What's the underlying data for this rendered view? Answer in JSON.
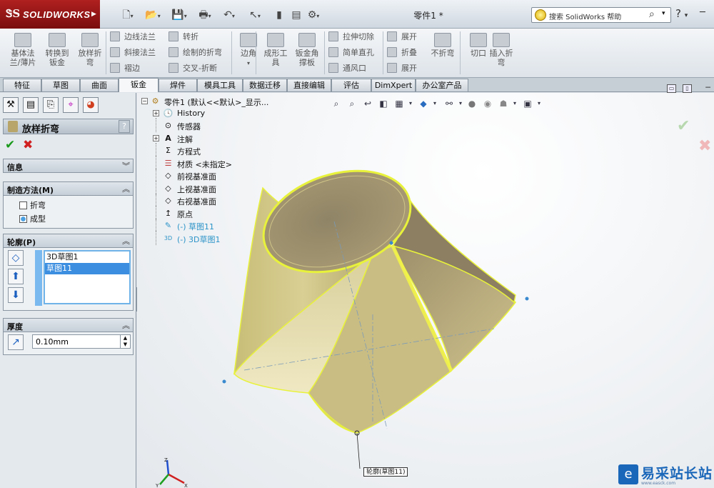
{
  "app": {
    "brand": "SOLIDWORKS",
    "doc_title": "零件1 *",
    "help_search": "搜索 SolidWorks 帮助",
    "help_btn": "?"
  },
  "ribbon": {
    "big_buttons": [
      {
        "label": "基体法兰/薄片",
        "lines": [
          "基体法",
          "兰/薄片"
        ]
      },
      {
        "label": "转换到钣金",
        "lines": [
          "转换到",
          "钣金"
        ]
      },
      {
        "label": "放样折弯",
        "lines": [
          "放样折",
          "弯"
        ]
      },
      {
        "label": "边角",
        "lines": [
          "边角"
        ]
      },
      {
        "label": "成形工具",
        "lines": [
          "成形工",
          "具"
        ]
      },
      {
        "label": "钣金角撑板",
        "lines": [
          "钣金角",
          "撑板"
        ]
      },
      {
        "label": "不折弯",
        "lines": [
          "不折弯"
        ]
      },
      {
        "label": "切口",
        "lines": [
          "切口"
        ]
      },
      {
        "label": "插入折弯",
        "lines": [
          "插入折",
          "弯"
        ]
      }
    ],
    "small_buttons": {
      "edge_flange": "边线法兰",
      "sketched_bend": "转折",
      "miter_flange": "斜接法兰",
      "jog": "绘制的折弯",
      "hem": "褶边",
      "cross_break": "交叉-折断",
      "extruded_cut": "拉伸切除",
      "simple_hole": "简单直孔",
      "vent": "通风口",
      "unfold": "展开",
      "fold": "折叠",
      "flatten": "展开"
    }
  },
  "tabs": [
    {
      "label": "特征",
      "active": false
    },
    {
      "label": "草图",
      "active": false
    },
    {
      "label": "曲面",
      "active": false
    },
    {
      "label": "钣金",
      "active": true
    },
    {
      "label": "焊件",
      "active": false
    },
    {
      "label": "模具工具",
      "active": false
    },
    {
      "label": "数据迁移",
      "active": false
    },
    {
      "label": "直接编辑",
      "active": false
    },
    {
      "label": "评估",
      "active": false
    },
    {
      "label": "DimXpert",
      "active": false
    },
    {
      "label": "办公室产品",
      "active": false
    }
  ],
  "property_manager": {
    "title": "放样折弯",
    "help": "?",
    "info_group": {
      "title": "信息"
    },
    "method_group": {
      "title": "制造方法(M)",
      "options": [
        {
          "label": "折弯",
          "checked": false
        },
        {
          "label": "成型",
          "checked": true
        }
      ]
    },
    "profile_group": {
      "title": "轮廓(P)",
      "items": [
        {
          "label": "3D草图1",
          "selected": false
        },
        {
          "label": "草图11",
          "selected": true
        }
      ]
    },
    "thickness_group": {
      "title": "厚度",
      "value": "0.10mm"
    }
  },
  "feature_tree": {
    "root": "零件1 (默认<<默认>_显示...",
    "items": [
      {
        "label": "History",
        "icon": "history-icon",
        "expandable": true,
        "blue": false
      },
      {
        "label": "传感器",
        "icon": "sensor-icon",
        "expandable": false,
        "blue": false
      },
      {
        "label": "注解",
        "icon": "annotation-icon",
        "expandable": true,
        "blue": false
      },
      {
        "label": "方程式",
        "icon": "equation-icon",
        "expandable": false,
        "blue": false
      },
      {
        "label": "材质 <未指定>",
        "icon": "material-icon",
        "expandable": false,
        "blue": false
      },
      {
        "label": "前视基准面",
        "icon": "plane-icon",
        "expandable": false,
        "blue": false
      },
      {
        "label": "上视基准面",
        "icon": "plane-icon",
        "expandable": false,
        "blue": false
      },
      {
        "label": "右视基准面",
        "icon": "plane-icon",
        "expandable": false,
        "blue": false
      },
      {
        "label": "原点",
        "icon": "origin-icon",
        "expandable": false,
        "blue": false
      },
      {
        "label": "(-) 草图11",
        "icon": "sketch-icon",
        "expandable": false,
        "blue": true
      },
      {
        "label": "(-) 3D草图1",
        "icon": "3d-sketch-icon",
        "expandable": false,
        "blue": true
      }
    ]
  },
  "viewport": {
    "callout": "轮廓(草图11)",
    "watermark": "易采站长站",
    "watermark_url": "www.easck.com"
  },
  "colors": {
    "model_fill": "#b8ad6a",
    "model_edge": "#e8f23a",
    "accent": "#3c8ee0"
  }
}
